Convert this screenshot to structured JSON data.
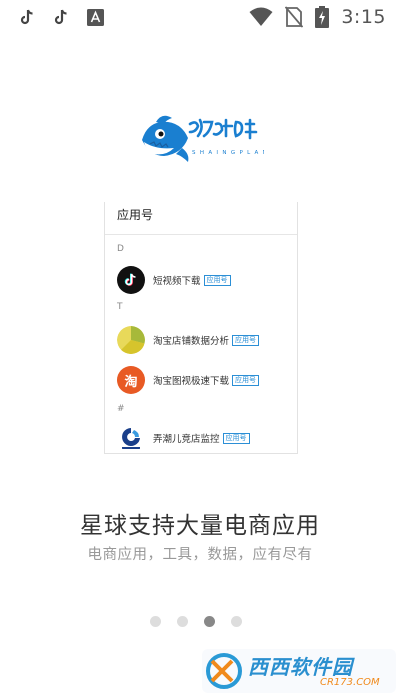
{
  "status_bar": {
    "time": "3:15",
    "left_icons": [
      "tiktok-icon",
      "tiktok-icon",
      "font-a-icon"
    ],
    "right_icons": [
      "wifi-icon",
      "no-sim-icon",
      "battery-charging-icon"
    ]
  },
  "logo": {
    "name": "fish-logo"
  },
  "card": {
    "title": "应用号",
    "sections": [
      {
        "letter": "D",
        "apps": [
          {
            "name": "短视频下载",
            "tag": "应用号",
            "icon": "tiktok-icon"
          }
        ]
      },
      {
        "letter": "T",
        "apps": [
          {
            "name": "淘宝店铺数据分析",
            "tag": "应用号",
            "icon": "pie-chart-icon"
          },
          {
            "name": "淘宝图视极速下载",
            "tag": "应用号",
            "icon": "taobao-icon"
          }
        ]
      },
      {
        "letter": "#",
        "apps": [
          {
            "name": "弄潮儿竞店监控",
            "tag": "应用号",
            "icon": "nongchaoer-icon"
          }
        ]
      }
    ]
  },
  "headline": "星球支持大量电商应用",
  "subline": "电商应用，工具，数据，应有尽有",
  "pagination": {
    "total": 4,
    "active_index": 2
  },
  "watermark": {
    "main": "西西软件园",
    "sub": "CR173.COM"
  },
  "colors": {
    "tag_blue": "#2b8fd6",
    "dot_active": "#888888",
    "dot_inactive": "#dddddd",
    "logo_blue": "#1a7fd0"
  }
}
